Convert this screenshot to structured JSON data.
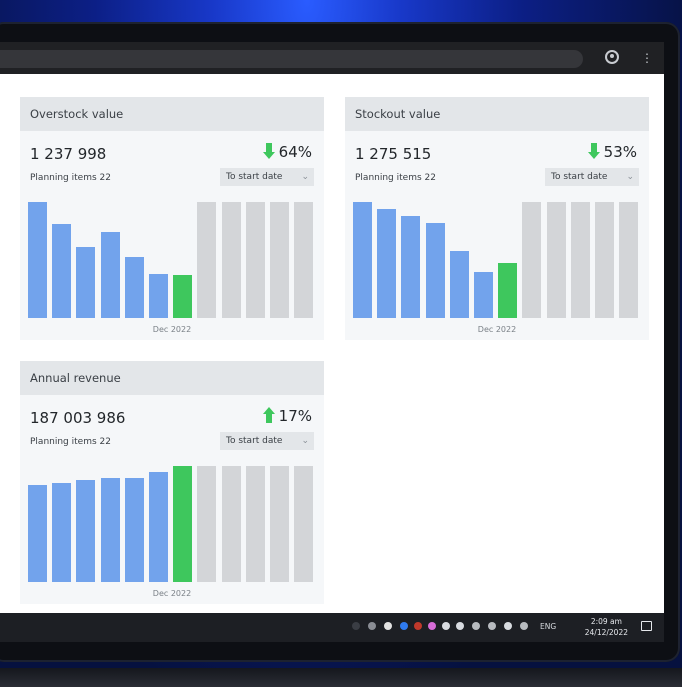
{
  "cards": {
    "overstock": {
      "title": "Overstock value",
      "value": "1 237 998",
      "change": "64%",
      "change_direction": "down",
      "sub": "Planning items 22",
      "select": "To start date",
      "month": "Dec 2022",
      "bars": [
        1.0,
        0.81,
        0.61,
        0.74,
        0.53,
        0.38,
        0.37,
        1.0,
        1.0,
        1.0,
        1.0,
        1.0
      ],
      "bar_states": [
        "past",
        "past",
        "past",
        "past",
        "past",
        "past",
        "current",
        "future",
        "future",
        "future",
        "future",
        "future"
      ]
    },
    "stockout": {
      "title": "Stockout value",
      "value": "1 275 515",
      "change": "53%",
      "change_direction": "down",
      "sub": "Planning items 22",
      "select": "To start date",
      "month": "Dec 2022",
      "bars": [
        1.0,
        0.94,
        0.88,
        0.82,
        0.58,
        0.4,
        0.47,
        1.0,
        1.0,
        1.0,
        1.0,
        1.0
      ],
      "bar_states": [
        "past",
        "past",
        "past",
        "past",
        "past",
        "past",
        "current",
        "future",
        "future",
        "future",
        "future",
        "future"
      ]
    },
    "revenue": {
      "title": "Annual revenue",
      "value": "187 003 986",
      "change": "17%",
      "change_direction": "up",
      "sub": "Planning items 22",
      "select": "To start date",
      "month": "Dec 2022",
      "bars": [
        0.84,
        0.85,
        0.88,
        0.9,
        0.9,
        0.95,
        1.0,
        1.0,
        1.0,
        1.0,
        1.0,
        1.0
      ],
      "bar_states": [
        "past",
        "past",
        "past",
        "past",
        "past",
        "past",
        "current",
        "future",
        "future",
        "future",
        "future",
        "future"
      ]
    }
  },
  "colors": {
    "past": "#72a3ec",
    "current": "#3ec75d",
    "future": "#d3d5d8",
    "arrow": "#3ec75d"
  },
  "taskbar": {
    "language": "ENG",
    "time": "2:09 am",
    "date": "24/12/2022"
  },
  "icons": [
    "profile-icon",
    "menu-dots-icon",
    "down-arrow-icon",
    "up-arrow-icon",
    "chevron-down-icon",
    "notification-icon"
  ]
}
